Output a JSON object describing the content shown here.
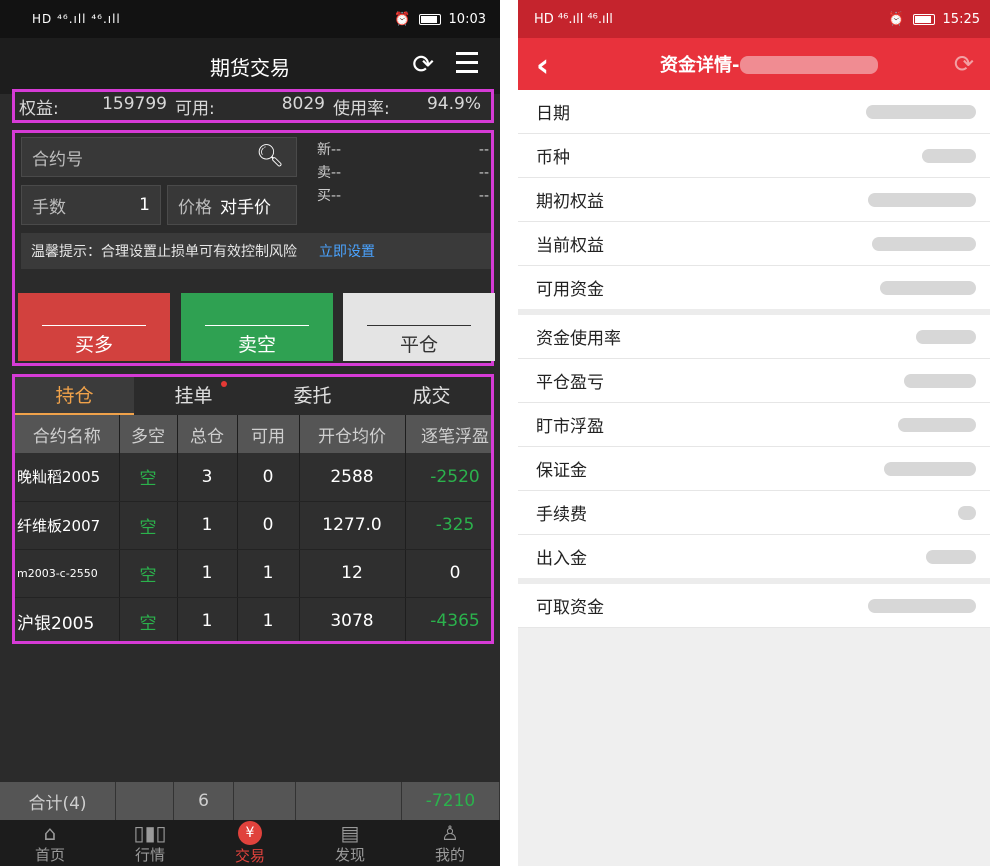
{
  "left": {
    "status": {
      "signals": "HD ⁴⁶.ıll ⁴⁶.ıll",
      "time": "10:03"
    },
    "header": {
      "title": "期货交易"
    },
    "account": {
      "equity_label": "权益:",
      "equity_value": "159799",
      "available_label": "可用:",
      "available_value": "8029",
      "usage_label": "使用率:",
      "usage_value": "94.9%"
    },
    "order": {
      "contract_placeholder": "合约号",
      "lots_label": "手数",
      "lots_value": "1",
      "price_label": "价格",
      "price_value": "对手价",
      "quote": [
        {
          "label": "新--",
          "value": "--"
        },
        {
          "label": "卖--",
          "value": "--"
        },
        {
          "label": "买--",
          "value": "--"
        }
      ],
      "tip_text": "温馨提示：合理设置止损单可有效控制风险",
      "tip_link": "立即设置",
      "buy_label": "买多",
      "sell_label": "卖空",
      "close_label": "平仓"
    },
    "tabs": [
      "持仓",
      "挂单",
      "委托",
      "成交"
    ],
    "table": {
      "headers": [
        "合约名称",
        "多空",
        "总仓",
        "可用",
        "开仓均价",
        "逐笔浮盈"
      ],
      "rows": [
        [
          "晚籼稻2005",
          "空",
          "3",
          "0",
          "2588",
          "-2520"
        ],
        [
          "纤维板2007",
          "空",
          "1",
          "0",
          "1277.0",
          "-325"
        ],
        [
          "m2003-c-2550",
          "空",
          "1",
          "1",
          "12",
          "0"
        ],
        [
          "沪银2005",
          "空",
          "1",
          "1",
          "3078",
          "-4365"
        ]
      ]
    },
    "total": {
      "label": "合计(4)",
      "qty": "6",
      "pnl": "-7210"
    },
    "nav": [
      {
        "label": "首页",
        "icon": "home-icon"
      },
      {
        "label": "行情",
        "icon": "chart-icon"
      },
      {
        "label": "交易",
        "icon": "yen-icon"
      },
      {
        "label": "发现",
        "icon": "news-icon"
      },
      {
        "label": "我的",
        "icon": "user-icon"
      }
    ]
  },
  "right": {
    "status": {
      "signals": "HD ⁴⁶.ıll ⁴⁶.ıll",
      "time": "15:25"
    },
    "header": {
      "title": "资金详情-"
    },
    "rows": [
      "日期",
      "币种",
      "期初权益",
      "当前权益",
      "可用资金",
      "资金使用率",
      "平仓盈亏",
      "盯市浮盈",
      "保证金",
      "手续费",
      "出入金",
      "可取资金"
    ]
  }
}
